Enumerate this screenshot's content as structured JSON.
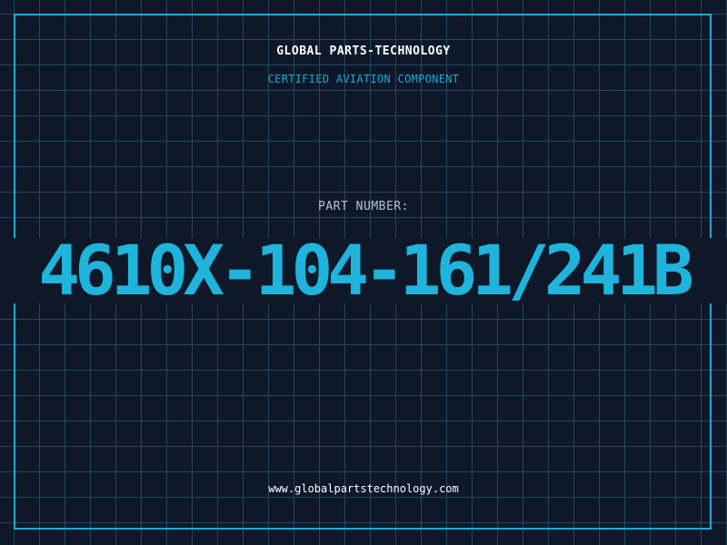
{
  "header": {
    "brand": "GLOBAL PARTS-TECHNOLOGY",
    "tagline": "CERTIFIED AVIATION COMPONENT"
  },
  "part": {
    "label": "PART NUMBER:",
    "number": "4610X-104-161/241B"
  },
  "footer": {
    "website": "www.globalpartstechnology.com"
  },
  "colors": {
    "background": "#0e1829",
    "grid": "#1f4a5e",
    "accent": "#1eb4dc",
    "text": "#ffffff"
  }
}
